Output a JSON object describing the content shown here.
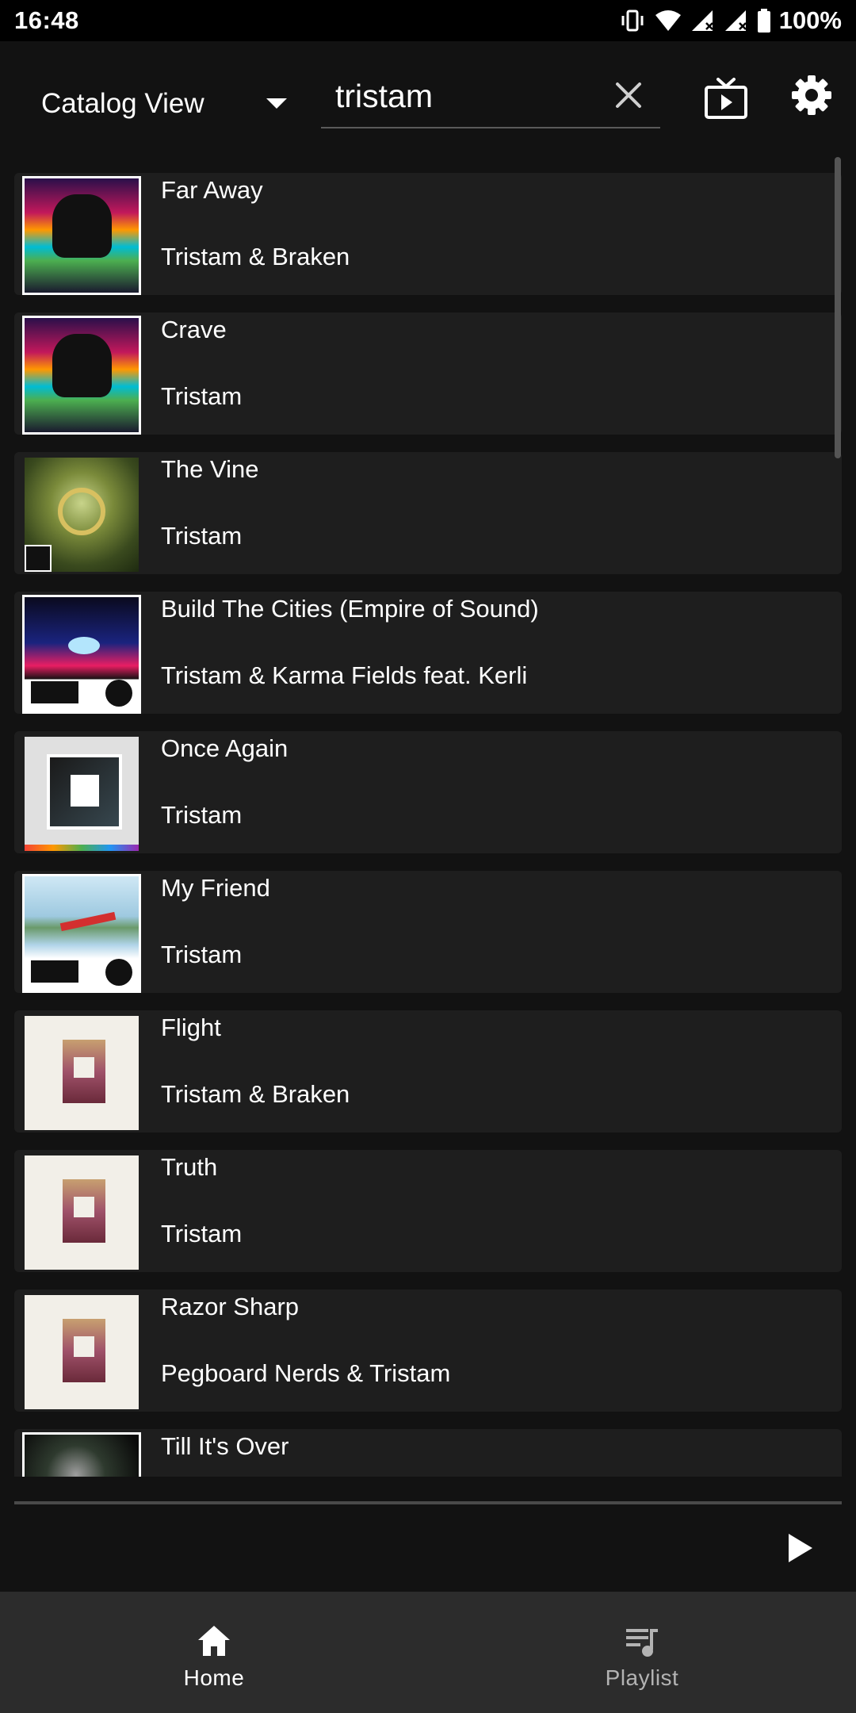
{
  "status": {
    "time": "16:48",
    "battery": "100%"
  },
  "header": {
    "view_selector": "Catalog View",
    "search_value": "tristam"
  },
  "tracks": [
    {
      "title": "Far Away",
      "artist": "Tristam & Braken"
    },
    {
      "title": "Crave",
      "artist": "Tristam"
    },
    {
      "title": "The Vine",
      "artist": "Tristam"
    },
    {
      "title": "Build The Cities (Empire of Sound)",
      "artist": "Tristam & Karma Fields feat. Kerli"
    },
    {
      "title": "Once Again",
      "artist": "Tristam"
    },
    {
      "title": "My Friend",
      "artist": "Tristam"
    },
    {
      "title": "Flight",
      "artist": "Tristam & Braken"
    },
    {
      "title": "Truth",
      "artist": "Tristam"
    },
    {
      "title": "Razor Sharp",
      "artist": "Pegboard Nerds & Tristam"
    },
    {
      "title": "Till It's Over",
      "artist": ""
    }
  ],
  "nav": {
    "home": "Home",
    "playlist": "Playlist"
  },
  "colors": {
    "background": "#121212",
    "row": "#1e1e1e",
    "nav": "#2c2c2c"
  }
}
